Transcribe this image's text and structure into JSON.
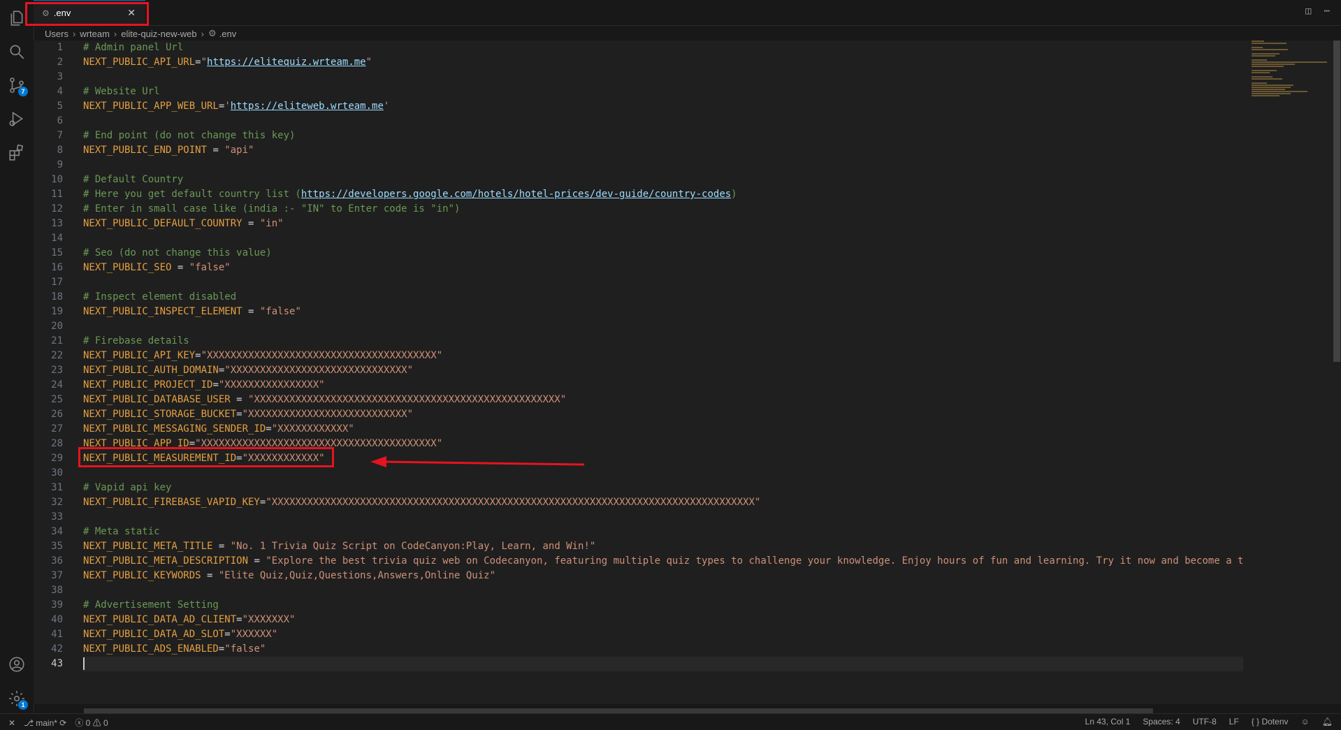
{
  "tab": {
    "title": ".env",
    "close_glyph": "✕"
  },
  "breadcrumb": [
    "Users",
    "wrteam",
    "elite-quiz-new-web",
    ".env"
  ],
  "editor": {
    "active_line": 43,
    "lines": [
      [
        {
          "t": "c",
          "v": "# Admin panel Url"
        }
      ],
      [
        {
          "t": "k",
          "v": "NEXT_PUBLIC_API_URL"
        },
        {
          "t": "o",
          "v": "="
        },
        {
          "t": "s",
          "v": "\""
        },
        {
          "t": "u",
          "v": "https://elitequiz.wrteam.me"
        },
        {
          "t": "s",
          "v": "\""
        }
      ],
      [],
      [
        {
          "t": "c",
          "v": "# Website Url"
        }
      ],
      [
        {
          "t": "k",
          "v": "NEXT_PUBLIC_APP_WEB_URL"
        },
        {
          "t": "o",
          "v": "="
        },
        {
          "t": "s",
          "v": "'"
        },
        {
          "t": "u",
          "v": "https://eliteweb.wrteam.me"
        },
        {
          "t": "s",
          "v": "'"
        }
      ],
      [],
      [
        {
          "t": "c",
          "v": "# End point (do not change this key)"
        }
      ],
      [
        {
          "t": "k",
          "v": "NEXT_PUBLIC_END_POINT"
        },
        {
          "t": "o",
          "v": " = "
        },
        {
          "t": "s",
          "v": "\"api\""
        }
      ],
      [],
      [
        {
          "t": "c",
          "v": "# Default Country"
        }
      ],
      [
        {
          "t": "c",
          "v": "# Here you get default country list ("
        },
        {
          "t": "u",
          "v": "https://developers.google.com/hotels/hotel-prices/dev-guide/country-codes"
        },
        {
          "t": "c",
          "v": ")"
        }
      ],
      [
        {
          "t": "c",
          "v": "# Enter in small case like (india :- \"IN\" to Enter code is \"in\")"
        }
      ],
      [
        {
          "t": "k",
          "v": "NEXT_PUBLIC_DEFAULT_COUNTRY"
        },
        {
          "t": "o",
          "v": " = "
        },
        {
          "t": "s",
          "v": "\"in\""
        }
      ],
      [],
      [
        {
          "t": "c",
          "v": "# Seo (do not change this value)"
        }
      ],
      [
        {
          "t": "k",
          "v": "NEXT_PUBLIC_SEO"
        },
        {
          "t": "o",
          "v": " = "
        },
        {
          "t": "s",
          "v": "\"false\""
        }
      ],
      [],
      [
        {
          "t": "c",
          "v": "# Inspect element disabled"
        }
      ],
      [
        {
          "t": "k",
          "v": "NEXT_PUBLIC_INSPECT_ELEMENT"
        },
        {
          "t": "o",
          "v": " = "
        },
        {
          "t": "s",
          "v": "\"false\""
        }
      ],
      [],
      [
        {
          "t": "c",
          "v": "# Firebase details"
        }
      ],
      [
        {
          "t": "k",
          "v": "NEXT_PUBLIC_API_KEY"
        },
        {
          "t": "o",
          "v": "="
        },
        {
          "t": "s",
          "v": "\"XXXXXXXXXXXXXXXXXXXXXXXXXXXXXXXXXXXXXXX\""
        }
      ],
      [
        {
          "t": "k",
          "v": "NEXT_PUBLIC_AUTH_DOMAIN"
        },
        {
          "t": "o",
          "v": "="
        },
        {
          "t": "s",
          "v": "\"XXXXXXXXXXXXXXXXXXXXXXXXXXXXXX\""
        }
      ],
      [
        {
          "t": "k",
          "v": "NEXT_PUBLIC_PROJECT_ID"
        },
        {
          "t": "o",
          "v": "="
        },
        {
          "t": "s",
          "v": "\"XXXXXXXXXXXXXXXX\""
        }
      ],
      [
        {
          "t": "k",
          "v": "NEXT_PUBLIC_DATABASE_USER"
        },
        {
          "t": "o",
          "v": " = "
        },
        {
          "t": "s",
          "v": "\"XXXXXXXXXXXXXXXXXXXXXXXXXXXXXXXXXXXXXXXXXXXXXXXXXXXX\""
        }
      ],
      [
        {
          "t": "k",
          "v": "NEXT_PUBLIC_STORAGE_BUCKET"
        },
        {
          "t": "o",
          "v": "="
        },
        {
          "t": "s",
          "v": "\"XXXXXXXXXXXXXXXXXXXXXXXXXXX\""
        }
      ],
      [
        {
          "t": "k",
          "v": "NEXT_PUBLIC_MESSAGING_SENDER_ID"
        },
        {
          "t": "o",
          "v": "="
        },
        {
          "t": "s",
          "v": "\"XXXXXXXXXXXX\""
        }
      ],
      [
        {
          "t": "k",
          "v": "NEXT_PUBLIC_APP_ID"
        },
        {
          "t": "o",
          "v": "="
        },
        {
          "t": "s",
          "v": "\"XXXXXXXXXXXXXXXXXXXXXXXXXXXXXXXXXXXXXXXX\""
        }
      ],
      [
        {
          "t": "k",
          "v": "NEXT_PUBLIC_MEASUREMENT_ID"
        },
        {
          "t": "o",
          "v": "="
        },
        {
          "t": "s",
          "v": "\"XXXXXXXXXXXX\""
        }
      ],
      [],
      [
        {
          "t": "c",
          "v": "# Vapid api key"
        }
      ],
      [
        {
          "t": "k",
          "v": "NEXT_PUBLIC_FIREBASE_VAPID_KEY"
        },
        {
          "t": "o",
          "v": "="
        },
        {
          "t": "s",
          "v": "\"XXXXXXXXXXXXXXXXXXXXXXXXXXXXXXXXXXXXXXXXXXXXXXXXXXXXXXXXXXXXXXXXXXXXXXXXXXXXXXXXXX\""
        }
      ],
      [],
      [
        {
          "t": "c",
          "v": "# Meta static"
        }
      ],
      [
        {
          "t": "k",
          "v": "NEXT_PUBLIC_META_TITLE"
        },
        {
          "t": "o",
          "v": " = "
        },
        {
          "t": "s",
          "v": "\"No. 1 Trivia Quiz Script on CodeCanyon:Play, Learn, and Win!\""
        }
      ],
      [
        {
          "t": "k",
          "v": "NEXT_PUBLIC_META_DESCRIPTION"
        },
        {
          "t": "o",
          "v": " = "
        },
        {
          "t": "s",
          "v": "\"Explore the best trivia quiz web on Codecanyon, featuring multiple quiz types to challenge your knowledge. Enjoy hours of fun and learning. Try it now and become a tr"
        },
        {
          "t": "f",
          "v": "ivia master!\""
        }
      ],
      [
        {
          "t": "k",
          "v": "NEXT_PUBLIC_KEYWORDS"
        },
        {
          "t": "o",
          "v": " = "
        },
        {
          "t": "s",
          "v": "\"Elite Quiz,Quiz,Questions,Answers,Online Quiz\""
        }
      ],
      [],
      [
        {
          "t": "c",
          "v": "# Advertisement Setting"
        }
      ],
      [
        {
          "t": "k",
          "v": "NEXT_PUBLIC_DATA_AD_CLIENT"
        },
        {
          "t": "o",
          "v": "="
        },
        {
          "t": "s",
          "v": "\"XXXXXXX\""
        }
      ],
      [
        {
          "t": "k",
          "v": "NEXT_PUBLIC_DATA_AD_SLOT"
        },
        {
          "t": "o",
          "v": "="
        },
        {
          "t": "s",
          "v": "\"XXXXXX\""
        }
      ],
      [
        {
          "t": "k",
          "v": "NEXT_PUBLIC_ADS_ENABLED"
        },
        {
          "t": "o",
          "v": "="
        },
        {
          "t": "s",
          "v": "\"false\""
        }
      ],
      []
    ]
  },
  "activitybar": {
    "icons": [
      "explorer-icon",
      "search-icon",
      "source-control-icon",
      "run-debug-icon",
      "extensions-icon"
    ],
    "source_control_badge": "7",
    "settings_badge": "1"
  },
  "statusbar": {
    "branch": "main*",
    "errors": "0",
    "warnings": "0",
    "position": "Ln 43, Col 1",
    "spaces": "Spaces: 4",
    "encoding": "UTF-8",
    "eol": "LF",
    "language": "Dotenv"
  },
  "colors": {
    "highlight": "#e5141f",
    "accent": "#0078d4"
  }
}
